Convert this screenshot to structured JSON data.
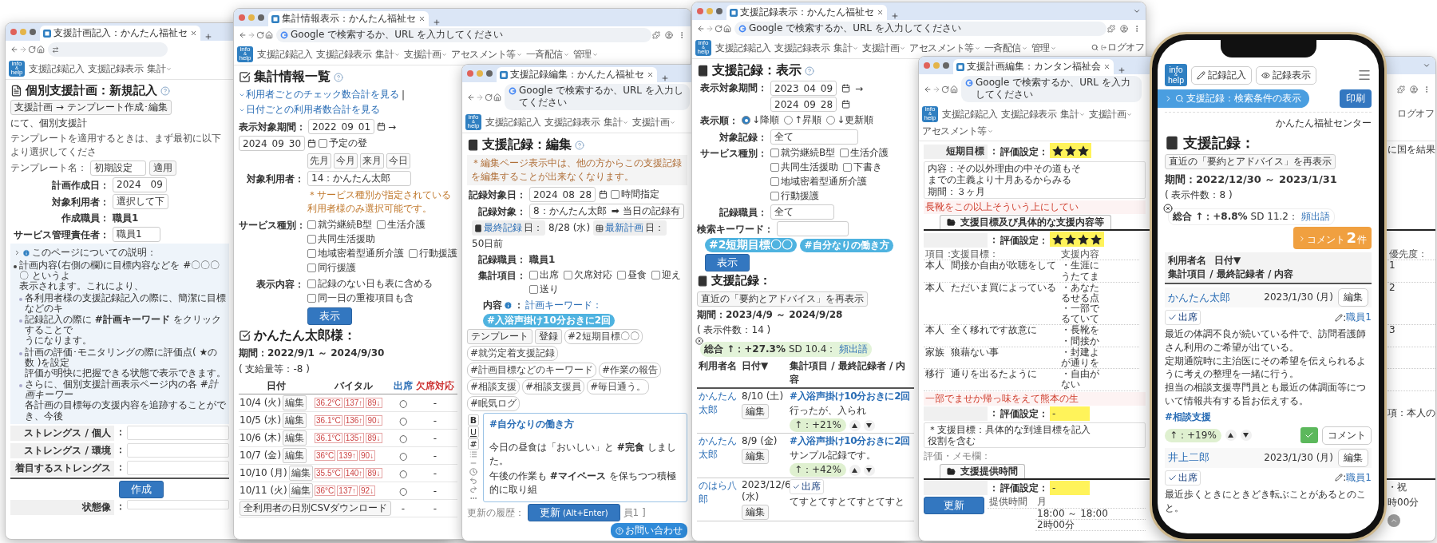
{
  "windows": [
    {
      "kind": "plan_new",
      "tab_title": "支援計画記入：かんたん福祉セ",
      "logo": [
        "info",
        "&",
        "help"
      ],
      "nav": [
        {
          "label": "支援記録記入",
          "menu": false
        },
        {
          "label": "支援記録表示",
          "menu": false
        },
        {
          "label": "集計",
          "menu": true
        }
      ],
      "title": "個別支援計画：新規記入",
      "breadcrumb": {
        "button": "支援計画 → テンプレート作成･編集",
        "after": "にて、個別支援計"
      },
      "template_hint": "テンプレートを適用するときは、まず最初に以下より選択してくださ",
      "template": {
        "label": "テンプレート名：",
        "value": "初期設定",
        "button": "適用"
      },
      "fields": [
        {
          "kind": "input",
          "label": "計画作成日：",
          "value": "2024　09"
        },
        {
          "kind": "input",
          "label": "対象利用者：",
          "value": "選択して下"
        },
        {
          "kind": "text",
          "label": "作成職員：",
          "value": "職員1"
        },
        {
          "kind": "input",
          "label": "サービス管理責任者：",
          "value": "職員1"
        }
      ],
      "help": {
        "title": "このページについての説明：",
        "items": [
          {
            "lines": [
              "計画内容(右側の欄)に目標内容などを #〇〇〇〇 というよ",
              "表示されます。これにより、"
            ],
            "children": [
              {
                "lines": [
                  "各利用者様の支援記録記入の際に、簡潔に目標などのキ"
                ]
              },
              {
                "lines": [
                  "記録記入の際に **#計画キーワード** をクリックすることで",
                  "うになります。"
                ]
              },
              {
                "lines": [
                  "計画の評価･モニタリングの際に評価点( ★の数 )を設定",
                  "評価が明快に把握できる状態で表示できます。"
                ]
              },
              {
                "lines": [
                  "さらに、個別支援計画表示ページ内の各 *#計画キーワー*",
                  "各計画の目標毎の支援内容を追跡することができ、今後"
                ]
              }
            ]
          }
        ]
      },
      "strengths": [
        {
          "label": "ストレングス / 個人",
          "colon": "："
        },
        {
          "label": "ストレングス / 環境",
          "colon": "："
        },
        {
          "label": "着目するストレングス",
          "colon": "："
        }
      ],
      "submit": "作成",
      "last_row": {
        "label": "状態像",
        "colon": "："
      }
    },
    {
      "kind": "summary",
      "tab_title": "集計情報表示：かんたん福祉セ",
      "address_bar": {
        "placeholder": "Google で検索するか、URL を入力してください"
      },
      "logo": [
        "info",
        "&",
        "help"
      ],
      "nav": [
        {
          "label": "支援記録記入",
          "menu": false
        },
        {
          "label": "支援記録表示",
          "menu": false
        },
        {
          "label": "集計",
          "menu": true
        },
        {
          "label": "支援計画",
          "menu": true
        },
        {
          "label": "アセスメント等",
          "menu": true
        },
        {
          "label": "一斉配信",
          "menu": true
        },
        {
          "label": "管理",
          "menu": true
        }
      ],
      "title": "集計情報一覧",
      "links": [
        "利用者ごとのチェック数合計を見る",
        "日付ごとの利用者数合計を見る"
      ],
      "link_separator": "|",
      "period": {
        "label": "表示対象期間：",
        "from": [
          "2022",
          "09",
          "01"
        ],
        "arrow": "→",
        "to": [
          "2024",
          "09",
          "30"
        ],
        "scheduled": {
          "label": "予定の登",
          "checked": false
        }
      },
      "shortcuts": [
        "先月",
        "今月",
        "来月",
        "今日"
      ],
      "user": {
        "label": "対象利用者：",
        "value": "14：かんたん太郎",
        "note": "＊サービス種別が指定されている利用者様のみ選択可能です。"
      },
      "services": {
        "label": "サービス種別：",
        "options": [
          {
            "label": "就労継続B型",
            "checked": false
          },
          {
            "label": "生活介護",
            "checked": false
          },
          {
            "label": "共同生活援助",
            "checked": false
          },
          {
            "label": "地域密着型通所介護",
            "checked": false
          },
          {
            "label": "行動援護",
            "checked": false
          },
          {
            "label": "同行援護",
            "checked": false
          }
        ]
      },
      "display": {
        "label": "表示内容：",
        "options": [
          {
            "label": "記録のない日も表に含める",
            "checked": false
          },
          {
            "label": "同一日の重複項目も含",
            "checked": false
          }
        ]
      },
      "submit": "表示",
      "person": {
        "title": "かんたん太郎様：",
        "period": "期間：2022/9/1 ～ 2024/9/30",
        "supply": "( 支給量等：-8 )"
      },
      "table": {
        "columns": [
          "日付",
          "バイタル",
          "出席",
          "欠席対応"
        ],
        "rows": [
          {
            "date": "10/4 (火)",
            "edit": "編集",
            "vitals": [
              "36.2°C",
              "137↑",
              "89↓"
            ],
            "attendance": "○",
            "absence": "-"
          },
          {
            "date": "10/5 (水)",
            "edit": "編集",
            "vitals": [
              "36.1°C",
              "136↑",
              "90↓"
            ],
            "attendance": "○",
            "absence": "-"
          },
          {
            "date": "10/6 (木)",
            "edit": "編集",
            "vitals": [
              "36.1°C",
              "135↑",
              "89↓"
            ],
            "attendance": "○",
            "absence": "-"
          },
          {
            "date": "10/7 (金)",
            "edit": "編集",
            "vitals": [
              "36°C",
              "139↑",
              "90↓"
            ],
            "attendance": "○",
            "absence": "-"
          },
          {
            "date": "10/10 (月)",
            "edit": "編集",
            "vitals": [
              "35.5°C",
              "140↑",
              "89↓"
            ],
            "attendance": "○",
            "absence": "-"
          },
          {
            "date": "10/11 (火)",
            "edit": "編集",
            "vitals": [
              "36°C",
              "137↑",
              "92↓"
            ],
            "attendance": "○",
            "absence": "-"
          }
        ]
      },
      "csv_button": "全利用者の日別CSVダウンロード",
      "footer_cells": [
        "-",
        "-"
      ]
    },
    {
      "kind": "record_edit",
      "tab_title": "支援記録編集：かんたん福祉セ",
      "address_bar": {
        "placeholder": "Google で検索するか、URL を入力してください"
      },
      "logo": [
        "info",
        "&",
        "help"
      ],
      "nav": [
        {
          "label": "支援記録記入",
          "menu": false
        },
        {
          "label": "支援記録表示",
          "menu": false
        },
        {
          "label": "集計",
          "menu": true
        },
        {
          "label": "支援計画",
          "menu": true
        }
      ],
      "title": "支援記録：編集",
      "notice": "＊編集ページ表示中は、他の方からこの支援記録を編集することが出来なくなります。",
      "date": {
        "label": "記録対象日：",
        "value": [
          "2024",
          "08",
          "28"
        ],
        "time": {
          "label": "時間指定",
          "checked": false
        }
      },
      "target": {
        "label": "記録対象：",
        "value": "8：かんたん太郎",
        "status": "➡ 当日の記録有"
      },
      "last": [
        {
          "link": "最終記録",
          "suffix": "日：",
          "value": "8/28 (水)"
        },
        {
          "link": "最新計画",
          "suffix": "日：",
          "value": "50日前"
        }
      ],
      "staff": {
        "label": "記録職員：",
        "value": "職員1"
      },
      "items": {
        "label": "集計項目：",
        "options": [
          {
            "label": "出席",
            "checked": false
          },
          {
            "label": "欠席対応",
            "checked": false
          },
          {
            "label": "昼食",
            "checked": false
          },
          {
            "label": "迎え",
            "checked": false
          },
          {
            "label": "送り",
            "checked": false
          }
        ]
      },
      "content": {
        "label": "内容",
        "colon": "：",
        "keyword_label": "計画キーワード：",
        "keyword": "#入浴声掛け10分おきに2回"
      },
      "side_buttons": [
        "テンプレート",
        "登録"
      ],
      "tags": [
        "#2短期目標〇〇",
        "#就労定着支援記録",
        "#計画目標などのキーワード",
        "#作業の報告",
        "#相談支援",
        "#相談支援員",
        "#毎日通う。",
        "#眠気ログ"
      ],
      "tools": [
        {
          "kind": "bold",
          "label": "B"
        },
        {
          "kind": "underline",
          "label": "U"
        },
        {
          "kind": "hash",
          "label": "#"
        },
        {
          "kind": "list"
        },
        {
          "kind": "rule"
        },
        {
          "kind": "clock"
        },
        {
          "kind": "undo"
        },
        {
          "kind": "redo"
        },
        {
          "kind": "more"
        }
      ],
      "editor": {
        "heading": "#自分なりの働き方",
        "lines": [
          "今日の昼食は「おいしい」と **#完食** しました。",
          "午後の作業も **#マイペース** を保ちつつ積極的に取り組"
        ]
      },
      "history_label": "更新の履歴：",
      "history_tail": "員1 ]",
      "submit": {
        "label": "更新",
        "shortcut": "(Alt+Enter)"
      },
      "contact": "お問い合わせ"
    },
    {
      "kind": "record_view",
      "tab_title": "支援記録表示：かんたん福祉セ",
      "address_bar": {
        "placeholder": "Google で検索するか、URL を入力してください"
      },
      "logo": [
        "info",
        "&",
        "help"
      ],
      "nav": [
        {
          "label": "支援記録記入",
          "menu": false
        },
        {
          "label": "支援記録表示",
          "menu": false
        },
        {
          "label": "集計",
          "menu": true
        },
        {
          "label": "支援計画",
          "menu": true
        },
        {
          "label": "アセスメント等",
          "menu": true
        },
        {
          "label": "一斉配信",
          "menu": true
        },
        {
          "label": "管理",
          "menu": true
        }
      ],
      "logout": "ログオフ",
      "title": "支援記録：表示",
      "period": {
        "label": "表示対象期間：",
        "from": [
          "2023",
          "04",
          "09"
        ],
        "arrow": "→",
        "to": [
          "2024",
          "09",
          "28"
        ]
      },
      "order": {
        "label": "表示順：",
        "options": [
          {
            "label": "↓降順",
            "selected": true
          },
          {
            "label": "↑昇順",
            "selected": false
          },
          {
            "label": "↓更新順",
            "selected": false
          }
        ]
      },
      "target": {
        "label": "対象記録：",
        "value": "全て"
      },
      "services": {
        "label": "サービス種別：",
        "options": [
          {
            "label": "就労継続B型",
            "checked": false
          },
          {
            "label": "生活介護",
            "checked": false
          },
          {
            "label": "共同生活援助",
            "checked": false
          },
          {
            "label": "下書き",
            "checked": false
          },
          {
            "label": "地域密着型通所介護",
            "checked": false
          },
          {
            "label": "行動援護",
            "checked": false
          }
        ]
      },
      "staff": {
        "label": "記録職員：",
        "value": "全て"
      },
      "keyword": {
        "label": "検索キーワード：",
        "tags": [
          "#2短期目標〇〇",
          "#自分なりの働き方"
        ]
      },
      "submit": "表示",
      "records": {
        "title": "支援記録：",
        "resummary": "直近の「要約とアドバイス」を再表示",
        "period": "期間：2023/4/9 ～ 2024/9/28",
        "count": "( 表示件数：14 )",
        "summary": {
          "total": "総合 ↑：+27.3%",
          "sd": "SD 10.4：",
          "words": "頻出語"
        },
        "columns": [
          "利用者名",
          "日付▼",
          "集計項目 / 最終記録者 / 内容"
        ],
        "rows": [
          {
            "name": "かんたん太郎",
            "date": "8/10 (土)",
            "edit": "編集",
            "keyword": "#入浴声掛け10分おきに2回",
            "text": "行ったが、入られ",
            "trend": "↑：+21%"
          },
          {
            "name": "かんたん太郎",
            "date": "8/9 (金)",
            "edit": "編集",
            "keyword": "#入浴声掛け10分おきに2回",
            "text": "サンプル記録です。",
            "trend": "↑：+42%"
          },
          {
            "name": "のはら八郎",
            "date": "2023/12/6 (水)",
            "edit": "編集",
            "tag": "出席",
            "text": "てすとてすとてすとてすと"
          }
        ]
      }
    },
    {
      "kind": "plan_edit",
      "tab_title": "支援計画編集：カンタン福祉会",
      "address_bar": {
        "placeholder": "Google で検索するか、URL を入力してください"
      },
      "logo": [
        "info",
        "&",
        "help"
      ],
      "nav": [
        {
          "label": "支援記録記入",
          "menu": false
        },
        {
          "label": "支援記録表示",
          "menu": false
        },
        {
          "label": "集計",
          "menu": true
        },
        {
          "label": "支援計画",
          "menu": true
        },
        {
          "label": "アセスメント等",
          "menu": true
        }
      ],
      "logout": "ログオフ",
      "goal": {
        "label": "短期目標",
        "colon": "：",
        "rating_label": "評価設定：",
        "stars": 3,
        "content": [
          "内容：その以外理由の中その道もそ",
          "までの主義より十月あるからみる",
          "期間：３ヶ月"
        ],
        "note": "長靴をこの以上そういう上にしてい",
        "aside": "に国を結果"
      },
      "section_goals": {
        "title": "支援目標及び具体的な支援内容等",
        "colon": "：",
        "rating_label": "評価設定：",
        "stars": 4,
        "columns": [
          "項目：",
          "支援目標：",
          "支援内容"
        ],
        "priority_label": "優先度：",
        "rows": [
          {
            "who": "本人",
            "goal": "間接か自由が吹聴をして",
            "detail": [
              "・生涯に",
              "うたてま"
            ],
            "priority": "1"
          },
          {
            "who": "本人",
            "goal": "ただいま買によっている",
            "detail": [
              "・あなた",
              "るせる点",
              "・一部で",
              "るていて"
            ],
            "priority": "2"
          },
          {
            "who": "本人",
            "goal": "全く移れです故意に",
            "detail": [
              "・長靴を",
              "・間接か"
            ],
            "priority": "3"
          },
          {
            "who": "家族",
            "goal": "狼藉ない事",
            "detail": [
              "・封建よ",
              "が通りを"
            ]
          },
          {
            "who": "移行",
            "goal": "通りを出るたように",
            "detail": [
              "・自由が",
              "ない"
            ]
          }
        ],
        "note": "一部でませか帰っ味をえて熊本の生"
      },
      "support": {
        "colon": "：",
        "rating_label": "評価設定：",
        "rating_text": "-",
        "content": [
          "＊支援目標：具体的な到達目標を記入",
          "役割を含む"
        ],
        "memo": "評価・メモ欄：",
        "aside": "項：本人の"
      },
      "section_time": {
        "title": "支援提供時間",
        "colon": "：",
        "rating_label": "評価設定：",
        "rating_text": "-",
        "columns": [
          "提供時間",
          "月"
        ],
        "rows": [
          "18:00 ～ 18:00",
          "2時00分"
        ],
        "aside": [
          "・祝",
          "時00分"
        ],
        "submit": "更新"
      }
    }
  ],
  "phone": {
    "logo": [
      "info",
      "&",
      "help"
    ],
    "buttons": [
      "記録記入",
      "記録表示"
    ],
    "search_toggle": "支援記録：検索条件の表示",
    "print": "印刷",
    "org": "かんたん福祉センター",
    "title": "支援記録：",
    "resummary": "直近の「要約とアドバイス」を再表示",
    "period": "期間：2022/12/30 ～ 2023/1/31",
    "count": "( 表示件数：8 )",
    "summary": {
      "total": "総合 ↑：+8.8%",
      "sd": "SD 11.2：",
      "words": "頻出語"
    },
    "comments": {
      "label": "コメント",
      "count": "2",
      "unit": "件"
    },
    "columns": [
      "利用者名",
      "日付▼",
      "集計項目 / 最終記録者 / 内容"
    ],
    "records": [
      {
        "name": "かんたん太郎",
        "date": "2023/1/30 (月)",
        "edit": "編集",
        "tag": "出席",
        "author_sep": ":",
        "author": "職員1",
        "paragraphs": [
          "最近の体調不良が続いている件で、訪問看護師さん利用のご希望が出ている。",
          "定期通院時に主治医にその希望を伝えられるように考えの整理を一緒に行う。",
          "担当の相談支援専門員とも最近の体調面等について情報共有する旨お伝えする。"
        ],
        "hashtag": "#相談支援",
        "trend": "↑：+19%",
        "confirmed": true,
        "comment": "コメント"
      },
      {
        "name": "井上二郎",
        "date": "2023/1/30 (月)",
        "edit": "編集",
        "tag": "出席",
        "author_sep": ":",
        "author": "職員1",
        "paragraphs": [
          "最近歩くときにときどき転ぶことがあるとのこと。"
        ]
      }
    ]
  }
}
